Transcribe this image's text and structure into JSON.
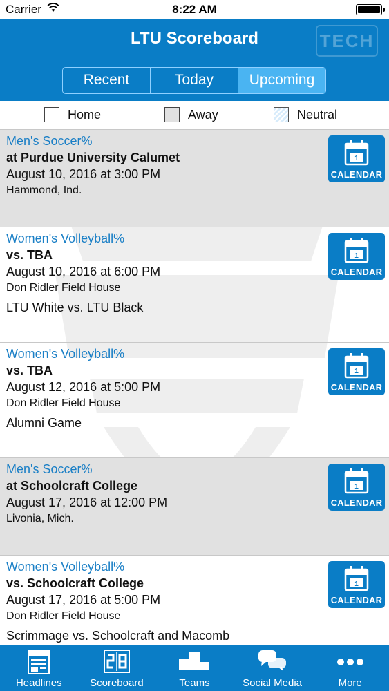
{
  "status": {
    "carrier": "Carrier",
    "time": "8:22 AM"
  },
  "header": {
    "title": "LTU Scoreboard",
    "logo": "TECH"
  },
  "segments": [
    {
      "label": "Recent",
      "active": false
    },
    {
      "label": "Today",
      "active": false
    },
    {
      "label": "Upcoming",
      "active": true
    }
  ],
  "legend": {
    "home": "Home",
    "away": "Away",
    "neutral": "Neutral"
  },
  "calendar_label": "CALENDAR",
  "calendar_day": "1",
  "games": [
    {
      "type": "away",
      "sport": "Men's Soccer%",
      "opponent": "at Purdue University Calumet",
      "datetime": "August 10, 2016 at 3:00 PM",
      "location": "Hammond, Ind.",
      "note": ""
    },
    {
      "type": "home",
      "sport": "Women's Volleyball%",
      "opponent": "vs. TBA",
      "datetime": "August 10, 2016 at 6:00 PM",
      "location": "Don Ridler Field House",
      "note": "LTU White vs. LTU Black"
    },
    {
      "type": "home",
      "sport": "Women's Volleyball%",
      "opponent": "vs. TBA",
      "datetime": "August 12, 2016 at 5:00 PM",
      "location": "Don Ridler Field House",
      "note": "Alumni Game"
    },
    {
      "type": "away",
      "sport": "Men's Soccer%",
      "opponent": "at Schoolcraft College",
      "datetime": "August 17, 2016 at 12:00 PM",
      "location": "Livonia, Mich.",
      "note": ""
    },
    {
      "type": "home",
      "sport": "Women's Volleyball%",
      "opponent": "vs. Schoolcraft College",
      "datetime": "August 17, 2016 at 5:00 PM",
      "location": "Don Ridler Field House",
      "note": "Scrimmage vs. Schoolcraft and Macomb"
    }
  ],
  "tabs": [
    {
      "label": "Headlines",
      "icon": "news-icon"
    },
    {
      "label": "Scoreboard",
      "icon": "scoreboard-icon"
    },
    {
      "label": "Teams",
      "icon": "teams-icon"
    },
    {
      "label": "Social Media",
      "icon": "chat-icon"
    },
    {
      "label": "More",
      "icon": "more-icon"
    }
  ],
  "colors": {
    "brand": "#0a7dc6",
    "active_segment": "#4ab4f2",
    "away_row": "#e1e1e1",
    "sport_text": "#1a7fc6"
  }
}
